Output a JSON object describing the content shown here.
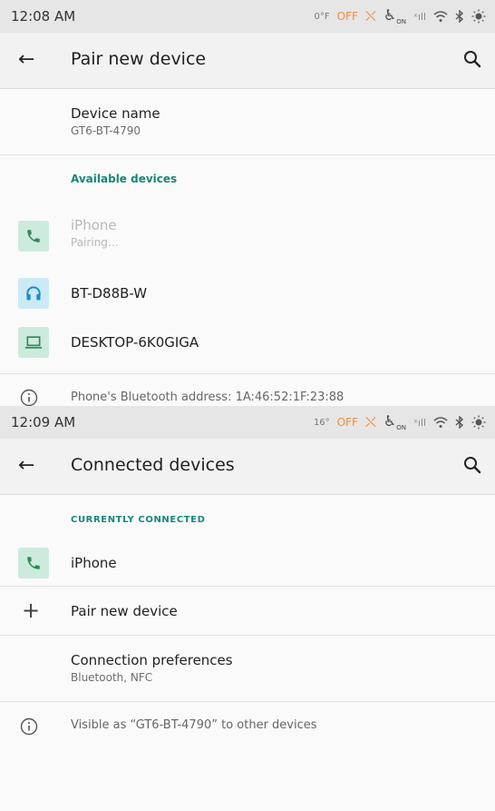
{
  "screen1": {
    "status": {
      "time": "12:08 AM",
      "temp": "0°F",
      "off": "OFF",
      "on": "ON",
      "signal": "ˣıll"
    },
    "title": "Pair new device",
    "device_name": {
      "label": "Device name",
      "value": "GT6-BT-4790"
    },
    "section": "Available devices",
    "devices": [
      {
        "name": "iPhone",
        "status": "Pairing…",
        "icon": "phone-icon"
      },
      {
        "name": "BT-D88B-W",
        "icon": "headset-icon"
      },
      {
        "name": "DESKTOP-6K0GIGA",
        "icon": "laptop-icon"
      }
    ],
    "footer": "Phone's Bluetooth address: 1A:46:52:1F:23:88"
  },
  "screen2": {
    "status": {
      "time": "12:09 AM",
      "temp": "16°",
      "off": "OFF",
      "on": "ON",
      "signal": "ˣıll"
    },
    "title": "Connected devices",
    "section": "CURRENTLY CONNECTED",
    "connected_device": {
      "name": "iPhone",
      "icon": "phone-icon"
    },
    "pair_new": "Pair new device",
    "connection_prefs": {
      "label": "Connection preferences",
      "value": "Bluetooth, NFC"
    },
    "footer": "Visible as “GT6-BT-4790” to other devices"
  },
  "colors": {
    "accent": "#16877b",
    "phone_icon": "#2e8b57",
    "headset_icon": "#1a8fc4",
    "laptop_icon": "#2e8b57",
    "warning": "#f28b3c"
  }
}
